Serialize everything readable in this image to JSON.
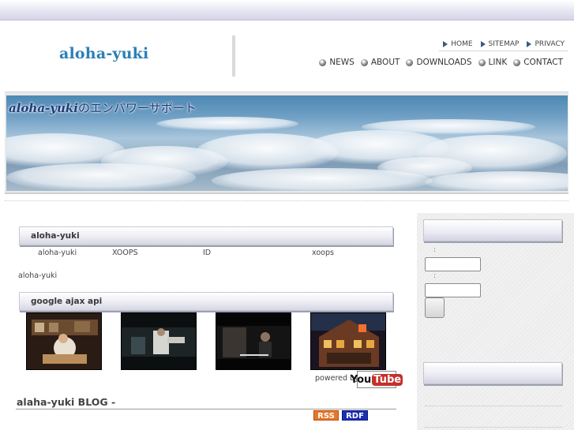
{
  "header": {
    "site_title": "aloha-yuki",
    "subnav": [
      "HOME",
      "SITEMAP",
      "PRIVACY"
    ],
    "mainnav": [
      "NEWS",
      "ABOUT",
      "DOWNLOADS",
      "LINK",
      "CONTACT"
    ]
  },
  "banner": {
    "brand": "aloha-yuki",
    "tagline": "のエンパワーサポート"
  },
  "main": {
    "block1": {
      "heading": "aloha-yuki",
      "row": [
        "aloha-yuki",
        "XOOPS",
        "ID",
        "xoops"
      ],
      "note": "aloha-yuki"
    },
    "block2": {
      "heading": "google ajax api",
      "videos": [
        "video-thumbnail-1",
        "video-thumbnail-2",
        "video-thumbnail-3",
        "video-thumbnail-4"
      ],
      "powered_by": "powered by",
      "youtube_you": "You",
      "youtube_tube": "Tube"
    },
    "blog": {
      "title": "alaha-yuki BLOG -",
      "rss_label": "RSS",
      "rdf_label": "RDF"
    }
  },
  "sidebar": {
    "username_label": ":",
    "password_label": ":",
    "username_value": "",
    "password_value": ""
  },
  "colors": {
    "title_blue": "#2b7fb6",
    "banner_text": "#1d3b78",
    "rss_orange": "#e8762b",
    "rdf_blue": "#1c2fb5",
    "youtube_red": "#c4302b"
  }
}
